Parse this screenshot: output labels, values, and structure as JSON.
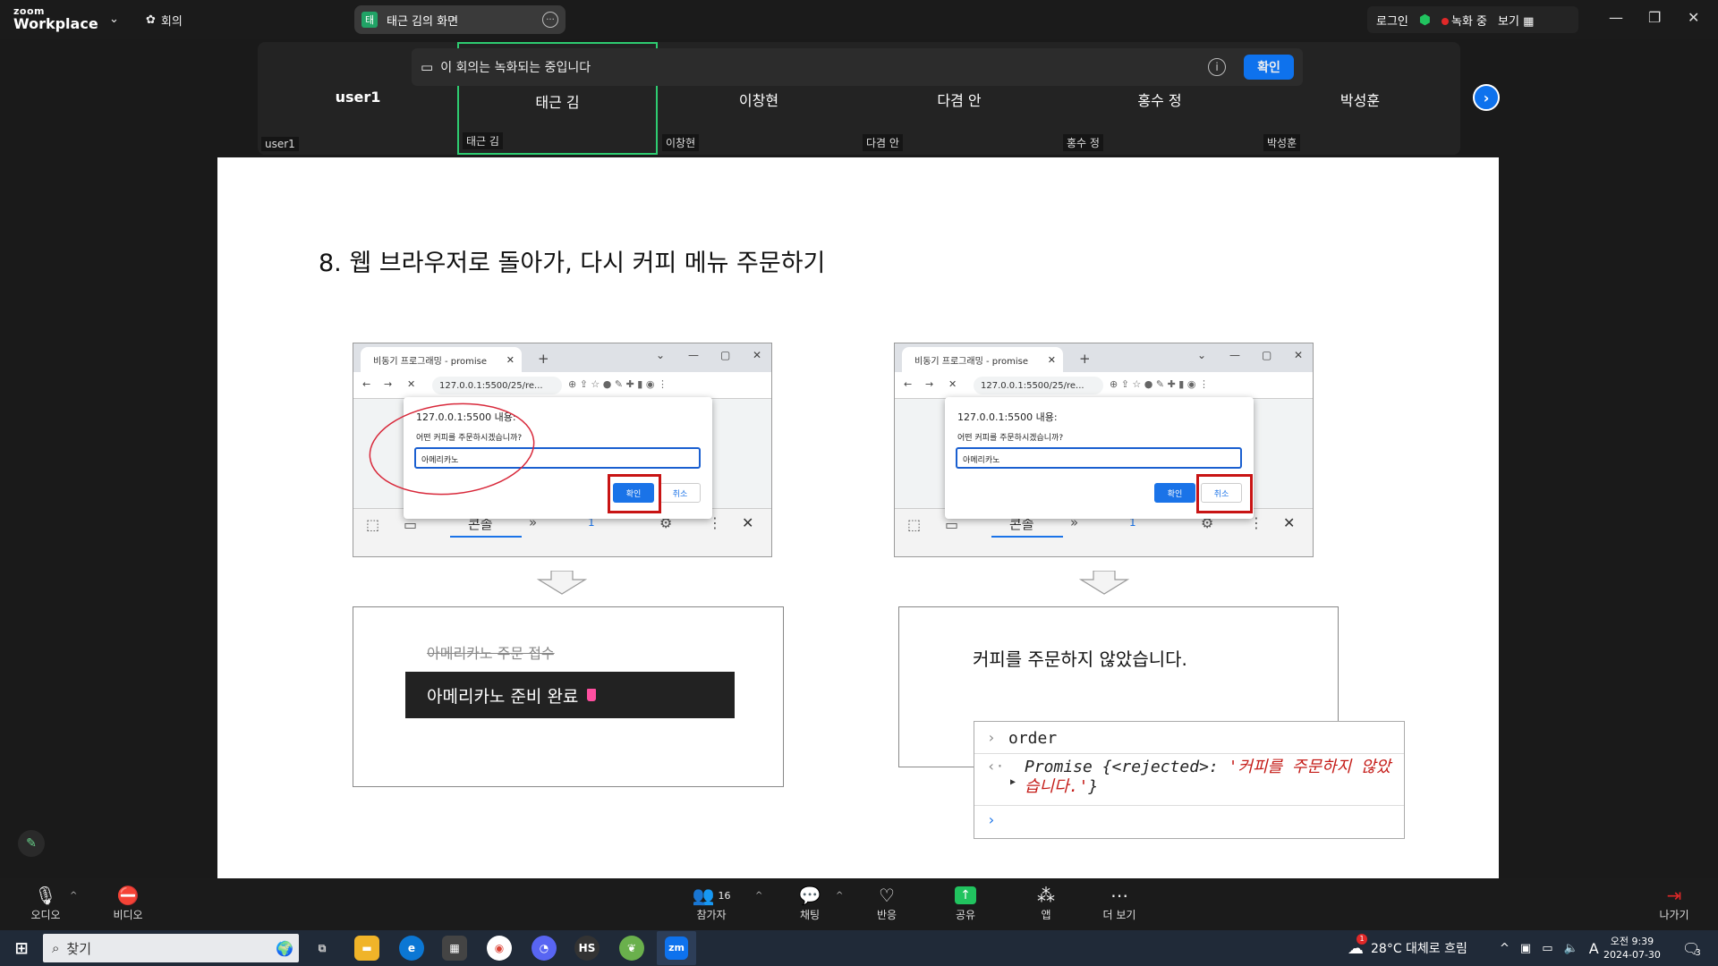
{
  "app": {
    "logo_top": "zoom",
    "logo_bottom": "Workplace",
    "meeting_menu": "회의",
    "share_tag": "태",
    "share_title": "태근 김의 화면",
    "login": "로그인",
    "recording": "녹화 중",
    "view": "보기"
  },
  "recbar": {
    "message": "이 회의는 녹화되는 중입니다",
    "confirm": "확인"
  },
  "gallery": {
    "tiles": [
      {
        "name": "user1",
        "label": "user1"
      },
      {
        "name": "태근 김",
        "label": "태근 김"
      },
      {
        "name": "이창현",
        "label": "이창현"
      },
      {
        "name": "다겸 안",
        "label": "다겸 안"
      },
      {
        "name": "홍수 정",
        "label": "홍수 정"
      },
      {
        "name": "박성훈",
        "label": "박성훈"
      }
    ]
  },
  "slide": {
    "title": "8. 웹 브라우저로 돌아가, 다시 커피 메뉴 주문하기",
    "browser_tab": "비동기 프로그래밍 - promise",
    "url": "127.0.0.1:5500/25/re...",
    "dialog_origin": "127.0.0.1:5500 내용:",
    "dialog_question": "어떤 커피를 주문하시겠습니까?",
    "dialog_value": "아메리카노",
    "dialog_ok": "확인",
    "dialog_cancel": "취소",
    "devtools_tab": "콘솔",
    "devtools_badge": "1",
    "left_result_strike": "아메리카노 주문 접수",
    "left_result_main": "아메리카노 준비 완료",
    "right_result": "커피를 주문하지 않았습니다.",
    "console": {
      "cmd": "order",
      "result_prefix": "Promise {<rejected>: ",
      "result_value": "'커피를 주문하지 않았습니다.'",
      "result_suffix": "}"
    }
  },
  "toolbar": {
    "audio": "오디오",
    "video": "비디오",
    "participants": "참가자",
    "participant_count": "16",
    "chat": "채팅",
    "reactions": "반응",
    "share": "공유",
    "apps": "앱",
    "more": "더 보기",
    "leave": "나가기"
  },
  "taskbar": {
    "search": "찾기",
    "weather": "28°C  대체로 흐림",
    "ime": "A",
    "time": "오전 9:39",
    "date": "2024-07-30",
    "notif_count": "3",
    "weather_badge": "1",
    "hs_label": "HS",
    "zm_label": "zm"
  },
  "colors": {
    "zoom_blue": "#0e72ed",
    "active_green": "#2ecc71",
    "record_red": "#e02828",
    "annotation_red": "#c81414"
  }
}
